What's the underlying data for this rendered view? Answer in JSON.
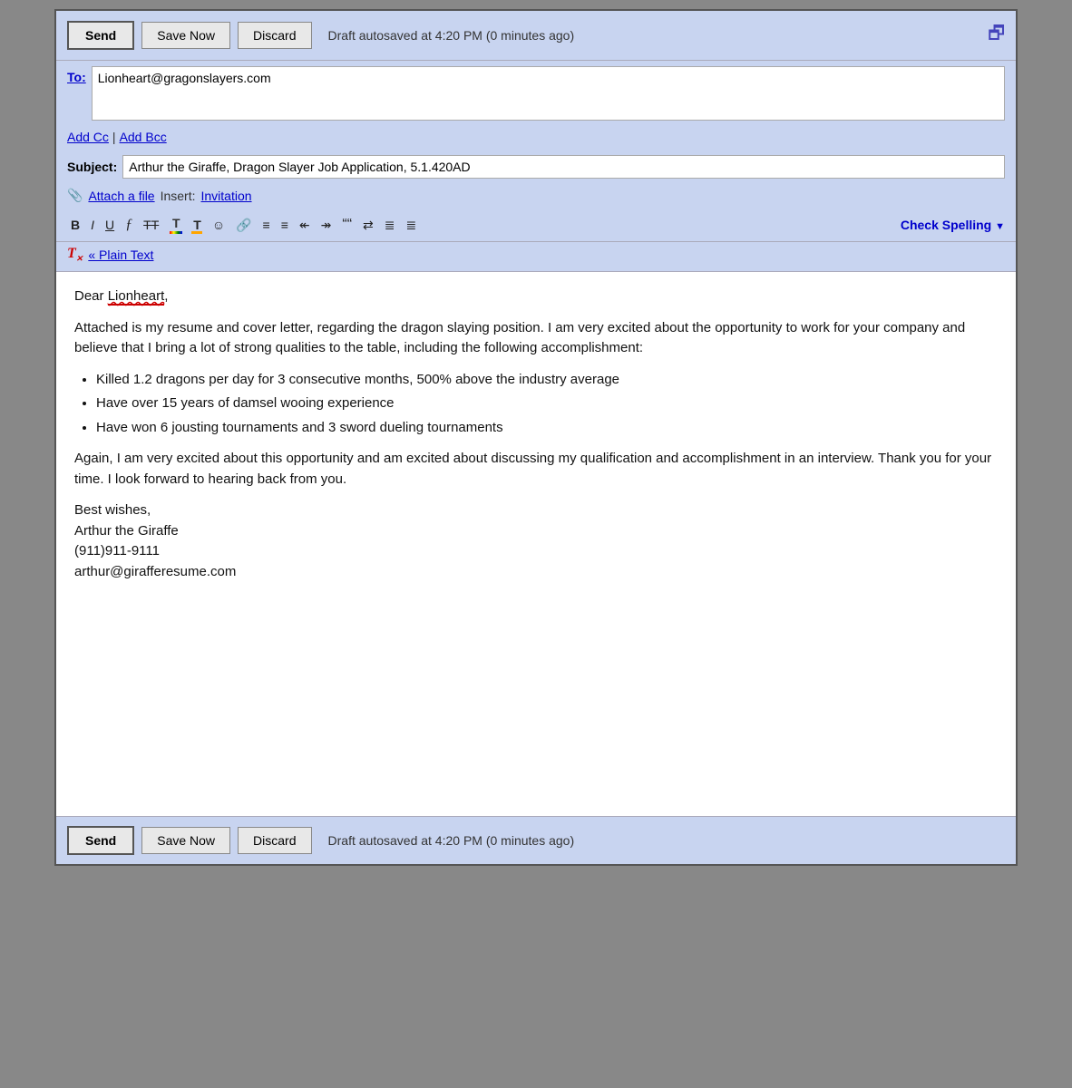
{
  "top_toolbar": {
    "send_label": "Send",
    "save_now_label": "Save Now",
    "discard_label": "Discard",
    "autosave_text": "Draft autosaved at 4:20 PM (0 minutes ago)"
  },
  "to_field": {
    "label": "To:",
    "value": "Lionheart@gragonslayers.com"
  },
  "cc_bcc": {
    "add_cc": "Add Cc",
    "pipe": "|",
    "add_bcc": "Add Bcc"
  },
  "subject_field": {
    "label": "Subject:",
    "value": "Arthur the Giraffe, Dragon Slayer Job Application, 5.1.420AD"
  },
  "attach_row": {
    "attach_label": "Attach a file",
    "insert_label": "Insert:",
    "invitation_label": "Invitation"
  },
  "format_toolbar": {
    "bold": "B",
    "italic": "I",
    "underline": "U",
    "font_script": "ƒ",
    "strikethrough": "T̶T",
    "font_color": "T",
    "remove_format": "T",
    "emoji": "☺",
    "link": "⛓",
    "num_list": "≡",
    "bullet_list": "≡",
    "indent_less": "◁≡",
    "indent_more": "≡▷",
    "blockquote": "❝❝",
    "align_left": "≡",
    "align_center": "≡",
    "align_right": "≡",
    "check_spelling": "Check Spelling",
    "check_spelling_arrow": "▼"
  },
  "plain_text": {
    "label": "« Plain Text"
  },
  "email_body": {
    "greeting": "Dear Lionheart,",
    "paragraph1": "Attached is my resume and cover letter, regarding the dragon slaying position.  I am very excited about the opportunity to work for your company and believe that I bring a lot of strong qualities to the table, including the following accomplishment:",
    "bullet1": "Killed 1.2 dragons per day for 3 consecutive months, 500% above the industry average",
    "bullet2": "Have over 15 years of damsel wooing experience",
    "bullet3": "Have won 6 jousting tournaments and 3 sword dueling tournaments",
    "paragraph2": "Again, I am very excited about this opportunity and am excited about discussing my qualification and accomplishment in an interview.  Thank you for your time.  I look forward to hearing back from you.",
    "signature_line1": "Best wishes,",
    "signature_line2": "Arthur the Giraffe",
    "signature_line3": "(911)911-9111",
    "signature_line4": "arthur@girafferesume.com"
  },
  "bottom_toolbar": {
    "send_label": "Send",
    "save_now_label": "Save Now",
    "discard_label": "Discard",
    "autosave_text": "Draft autosaved at 4:20 PM (0 minutes ago)"
  }
}
